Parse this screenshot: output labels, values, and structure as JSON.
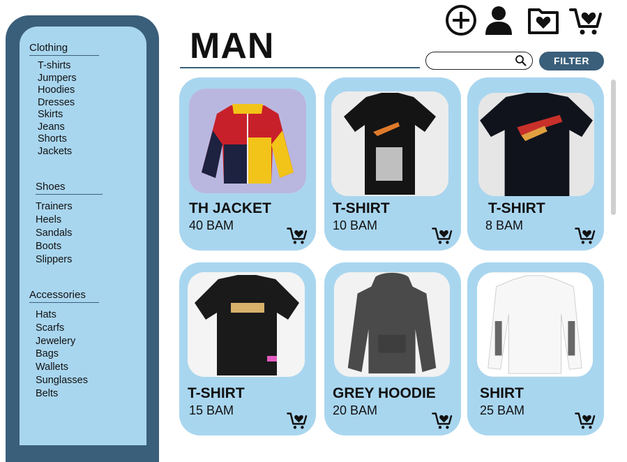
{
  "sidebar": {
    "categories": [
      {
        "title": "Clothing",
        "items": [
          "T-shirts",
          "Jumpers",
          "Hoodies",
          "Dresses",
          "Skirts",
          "Jeans",
          "Shorts",
          "Jackets"
        ]
      },
      {
        "title": "Shoes",
        "items": [
          "Trainers",
          "Heels",
          "Sandals",
          "Boots",
          "Slippers"
        ]
      },
      {
        "title": "Accessories",
        "items": [
          "Hats",
          "Scarfs",
          "Jewelery",
          "Bags",
          "Wallets",
          "Sunglasses",
          "Belts"
        ]
      }
    ]
  },
  "header": {
    "title": "MAN",
    "search_placeholder": "",
    "filter_label": "FILTER",
    "icons": [
      "add-icon",
      "user-icon",
      "favorites-folder-icon",
      "cart-icon"
    ]
  },
  "products": [
    {
      "name": "TH JACKET",
      "price": "40 BAM",
      "image": "jacket"
    },
    {
      "name": "T-SHIRT",
      "price": "10 BAM",
      "image": "tshirt-liberty"
    },
    {
      "name": "T-SHIRT",
      "price": "8 BAM",
      "image": "tshirt-graphic"
    },
    {
      "name": "T-SHIRT",
      "price": "15 BAM",
      "image": "tshirt-black"
    },
    {
      "name": "GREY HOODIE",
      "price": "20 BAM",
      "image": "hoodie-grey"
    },
    {
      "name": "SHIRT",
      "price": "25 BAM",
      "image": "longsleeve-white"
    }
  ],
  "colors": {
    "accent": "#3a5f7a",
    "panel": "#a9d6ef"
  }
}
